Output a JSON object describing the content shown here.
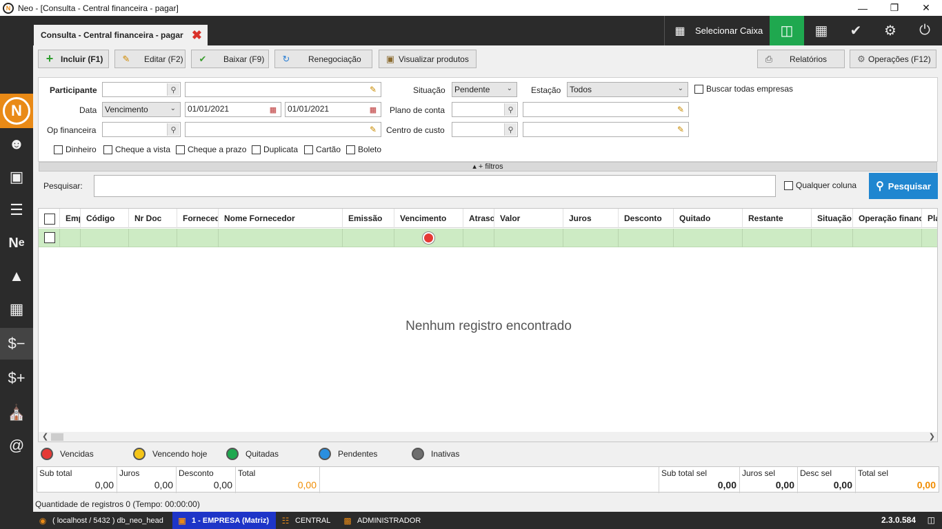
{
  "window": {
    "title": "Neo - [Consulta - Central financeira - pagar]",
    "logo_glyph": "N"
  },
  "tab": {
    "label": "Consulta - Central financeira - pagar"
  },
  "header": {
    "selecionar_caixa": "Selecionar Caixa",
    "active_color": "#1fa84f"
  },
  "toolbar": {
    "incluir": "Incluir (F1)",
    "editar": "Editar (F2)",
    "baixar": "Baixar (F9)",
    "renegociacao": "Renegociação",
    "visualizar": "Visualizar produtos",
    "relatorios": "Relatórios",
    "operacoes": "Operações (F12)"
  },
  "filters": {
    "participante_label": "Participante",
    "data_label": "Data",
    "data_tipo": "Vencimento",
    "data_inicio": "01/01/2021",
    "data_fim": "01/01/2021",
    "op_financeira_label": "Op financeira",
    "situacao_label": "Situação",
    "situacao_value": "Pendente",
    "estacao_label": "Estação",
    "estacao_value": "Todos",
    "buscar_todas": "Buscar todas empresas",
    "plano_conta_label": "Plano de conta",
    "centro_custo_label": "Centro de custo",
    "tipos": [
      "Dinheiro",
      "Cheque a vista",
      "Cheque a prazo",
      "Duplicata",
      "Cartão",
      "Boleto"
    ],
    "more_filters": "▴ + filtros"
  },
  "search": {
    "label": "Pesquisar:",
    "value": "",
    "qualquer_coluna": "Qualquer coluna",
    "button": "Pesquisar",
    "button_color": "#1f86d0"
  },
  "grid": {
    "columns": [
      "Emp",
      "Código",
      "Nr Doc",
      "Forneced",
      "Nome Fornecedor",
      "Emissão",
      "Vencimento",
      "Atraso",
      "Valor",
      "Juros",
      "Desconto",
      "Quitado",
      "Restante",
      "Situação",
      "Operação financ",
      "Pla"
    ],
    "empty_message": "Nenhum registro encontrado",
    "row_status_color": "#e53935"
  },
  "legend": {
    "vencidas": "Vencidas",
    "vencendo_hoje": "Vencendo hoje",
    "quitadas": "Quitadas",
    "pendentes": "Pendentes",
    "inativas": "Inativas",
    "colors": {
      "vencidas": "#e53935",
      "vencendo_hoje": "#f5c518",
      "quitadas": "#1fa84f",
      "pendentes": "#2a8fe0",
      "inativas": "#6e6e6e"
    }
  },
  "totals": {
    "sub_total_label": "Sub total",
    "sub_total": "0,00",
    "juros_label": "Juros",
    "juros": "0,00",
    "desconto_label": "Desconto",
    "desconto": "0,00",
    "total_label": "Total",
    "total": "0,00",
    "sub_total_sel_label": "Sub total sel",
    "sub_total_sel": "0,00",
    "juros_sel_label": "Juros sel",
    "juros_sel": "0,00",
    "desc_sel_label": "Desc sel",
    "desc_sel": "0,00",
    "total_sel_label": "Total sel",
    "total_sel": "0,00"
  },
  "quantidade": "Quantidade de registros 0 (Tempo: 00:00:00)",
  "statusbar": {
    "database": "( localhost / 5432 ) db_neo_head",
    "empresa": "1 - EMPRESA (Matriz)",
    "central": "CENTRAL",
    "usuario": "ADMINISTRADOR",
    "version": "2.3.0.584"
  }
}
